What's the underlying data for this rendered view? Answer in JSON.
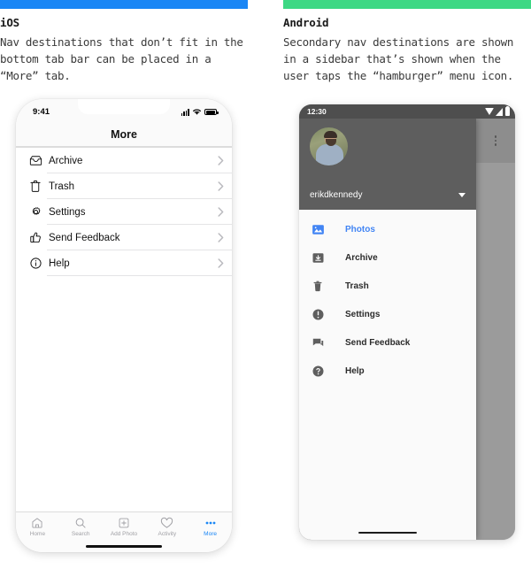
{
  "columns": {
    "ios": {
      "accent_color": "#1a86f5",
      "title": "iOS",
      "description": "Nav destinations that don’t fit in the bottom tab bar can be placed in a “More” tab."
    },
    "android": {
      "accent_color": "#3dd884",
      "title": "Android",
      "description": "Secondary nav destinations are shown in a sidebar that’s shown when the user taps the “hamburger” menu icon."
    }
  },
  "ios_phone": {
    "status": {
      "time": "9:41",
      "icons": [
        "cellular-signal-icon",
        "wifi-icon",
        "battery-icon"
      ]
    },
    "navbar_title": "More",
    "list_items": [
      {
        "label": "Archive",
        "icon": "archive-box-icon",
        "chevron": "chevron-right-icon"
      },
      {
        "label": "Trash",
        "icon": "trash-can-icon",
        "chevron": "chevron-right-icon"
      },
      {
        "label": "Settings",
        "icon": "gear-icon",
        "chevron": "chevron-right-icon"
      },
      {
        "label": "Send Feedback",
        "icon": "thumbs-up-icon",
        "chevron": "chevron-right-icon"
      },
      {
        "label": "Help",
        "icon": "info-circle-icon",
        "chevron": "chevron-right-icon"
      }
    ],
    "tabbar": {
      "active_color": "#1a86f5",
      "inactive_color": "#a0a0a5",
      "tabs": [
        {
          "label": "Home",
          "icon": "home-icon",
          "active": false
        },
        {
          "label": "Search",
          "icon": "search-icon",
          "active": false
        },
        {
          "label": "Add Photo",
          "icon": "plus-box-icon",
          "active": false
        },
        {
          "label": "Activity",
          "icon": "heart-icon",
          "active": false
        },
        {
          "label": "More",
          "icon": "ellipsis-icon",
          "active": true
        }
      ]
    }
  },
  "android_phone": {
    "status": {
      "time": "12:30",
      "icons": [
        "wifi-icon",
        "cellular-signal-icon",
        "battery-icon"
      ]
    },
    "overflow_menu_icon": "kebab-menu-icon",
    "drawer": {
      "avatar": "user-avatar",
      "username": "erikdkennedy",
      "caret": "chevron-down-icon",
      "items": [
        {
          "label": "Photos",
          "icon": "photo-icon",
          "selected": true
        },
        {
          "label": "Archive",
          "icon": "archive-box-icon",
          "selected": false
        },
        {
          "label": "Trash",
          "icon": "trash-can-icon",
          "selected": false
        },
        {
          "label": "Settings",
          "icon": "alert-circle-icon",
          "selected": false
        },
        {
          "label": "Send Feedback",
          "icon": "chat-bubble-icon",
          "selected": false
        },
        {
          "label": "Help",
          "icon": "question-circle-icon",
          "selected": false
        }
      ],
      "selected_color": "#4285f4"
    }
  }
}
